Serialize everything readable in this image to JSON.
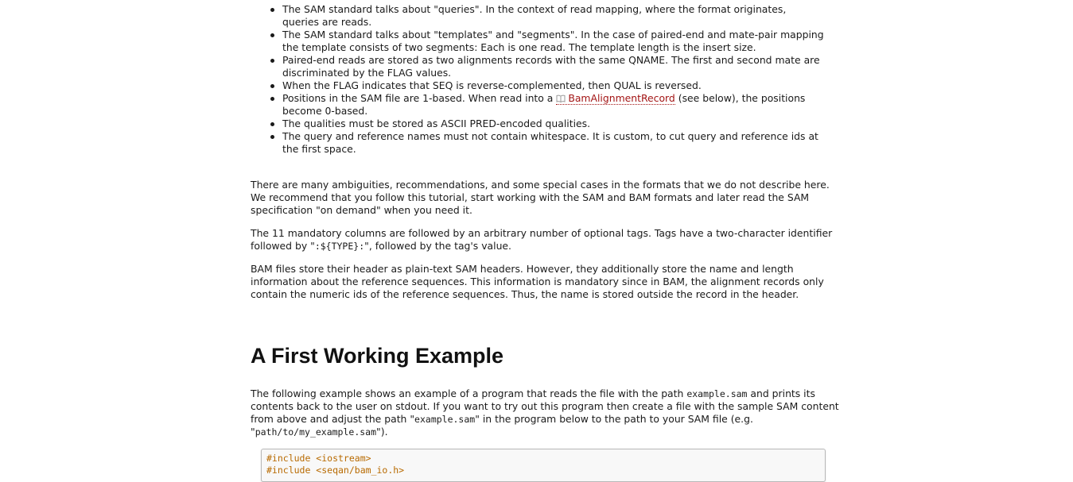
{
  "bullets": [
    "The SAM standard talks about \"queries\". In the context of read mapping, where the format originates, queries are reads.",
    "The SAM standard talks about \"templates\" and \"segments\". In the case of paired-end and mate-pair mapping the template consists of two segments: Each is one read. The template length is the insert size.",
    "Paired-end reads are stored as two alignments records with the same QNAME. The first and second mate are discriminated by the FLAG values.",
    "When the FLAG indicates that SEQ is reverse-complemented, then QUAL is reversed.",
    {
      "before": "Positions in the SAM file are 1-based. When read into a ",
      "link": "BamAlignmentRecord",
      "after": " (see below), the positions become 0-based."
    },
    "The qualities must be stored as ASCII PRED-encoded qualities.",
    "The query and reference names must not contain whitespace. It is custom, to cut query and reference ids at the first space."
  ],
  "para_ambiguities": "There are many ambiguities, recommendations, and some special cases in the formats that we do not describe here. We recommend that you follow this tutorial, start working with the SAM and BAM formats and later read the SAM specification \"on demand\" when you need it.",
  "para_tags": {
    "before": "The 11 mandatory columns are followed by an arbitrary number of optional tags. Tags have a two-character identifier followed by \"",
    "code": ":${TYPE}:",
    "after": "\", followed by the tag's value."
  },
  "para_bam": "BAM files store their header as plain-text SAM headers. However, they additionally store the name and length information about the reference sequences. This information is mandatory since in BAM, the alignment records only contain the numeric ids of the reference sequences. Thus, the name is stored outside the record in the header.",
  "section_title": "A First Working Example",
  "para_example": {
    "t1": "The following example shows an example of a program that reads the file with the path ",
    "c1": "example.sam",
    "t2": " and prints its contents back to the user on stdout. If you want to try out this program then create a file with the sample SAM content from above and adjust the path \"",
    "c2": "example.sam",
    "t3": "\" in the program below to the path to your SAM file (e.g. \"",
    "c3": "path/to/my_example.sam",
    "t4": "\")."
  },
  "code_lines": [
    "#include <iostream>",
    "#include <seqan/bam_io.h>"
  ],
  "colors": {
    "link": "#a31515",
    "code_preprocessor": "#b86a00"
  },
  "icons": {
    "link_icon": "book-icon"
  }
}
